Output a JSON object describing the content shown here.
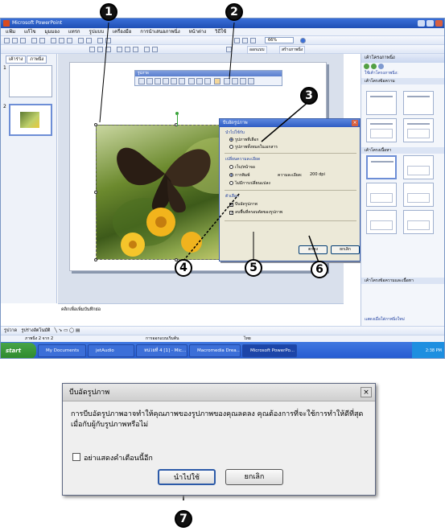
{
  "screenshot": {
    "title_bar": "Microsoft PowerPoint",
    "menu": [
      "แฟ้ม",
      "แก้ไข",
      "มุมมอง",
      "แทรก",
      "รูปแบบ",
      "เครื่องมือ",
      "การนำเสนอภาพนิ่ง",
      "หน้าต่าง",
      "วิธีใช้"
    ],
    "toolbar": {
      "zoom": "66%",
      "design_label": "ออกแบบ",
      "new_slide_label": "สร้างภาพนิ่ง"
    },
    "slide_tabs": {
      "outline": "เค้าร่าง",
      "slides": "ภาพนิ่ง"
    },
    "thumbnails": [
      "1",
      "2"
    ],
    "notes_text": "คลิกเพื่อเพิ่มบันทึกย่อ",
    "picture_toolbar_title": "รูปภาพ",
    "compress_dialog": {
      "title": "บีบอัดรูปภาพ",
      "apply_group": "นำไปใช้กับ",
      "apply_options": [
        "รูปภาพที่เลือก",
        "รูปภาพทั้งหมดในเอกสาร"
      ],
      "resolution_group": "เปลี่ยนความละเอียด",
      "resolution_options": [
        "เว็บ/หน้าจอ",
        "การพิมพ์",
        "ไม่มีการเปลี่ยนแปลง"
      ],
      "resolution_label": "ความละเอียด:",
      "resolution_value": "200 dpi",
      "options_group": "ตัวเลือก",
      "option_compress": "บีบอัดรูปภาพ",
      "option_delete_crop": "ลบพื้นที่ครอบตัดของรูปภาพ",
      "ok": "ตกลง",
      "cancel": "ยกเลิก"
    },
    "task_pane": {
      "title": "เค้าโครงภาพนิ่ง",
      "apply_label": "ใช้เค้าโครงภาพนิ่ง:",
      "section_text": "เค้าโครงข้อความ",
      "section_content": "เค้าโครงเนื้อหา",
      "section_text_content": "เค้าโครงข้อความและเนื้อหา",
      "footer": "แสดงเมื่อใส่ภาพนิ่งใหม่"
    },
    "drawing_bar": {
      "draw": "รูปวาด",
      "autoshapes": "รูปร่างอัตโนมัติ"
    },
    "status_bar": {
      "slide_info": "ภาพนิ่ง 2 จาก 2",
      "design": "การออกแบบเริ่มต้น",
      "language": "ไทย"
    },
    "taskbar": {
      "start": "start",
      "items": [
        "My Documents",
        "jetAudio",
        "หน่วยที่ 4 [1] - Mic...",
        "Macromedia Drea...",
        "Microsoft PowerPo..."
      ],
      "clock": "2:38 PM"
    }
  },
  "markers": [
    "1",
    "2",
    "3",
    "4",
    "5",
    "6",
    "7"
  ],
  "confirm_dialog": {
    "title": "บีบอัดรูปภาพ",
    "message": "การบีบอัดรูปภาพอาจทำให้คุณภาพของรูปภาพของคุณลดลง คุณต้องการที่จะใช้การทำให้ดีที่สุดเมื่อกับผู้กับรูปภาพหรือไม่",
    "dont_show": "อย่าแสดงคำเตือนนี้อีก",
    "apply": "นำไปใช้",
    "cancel": "ยกเลิก"
  }
}
